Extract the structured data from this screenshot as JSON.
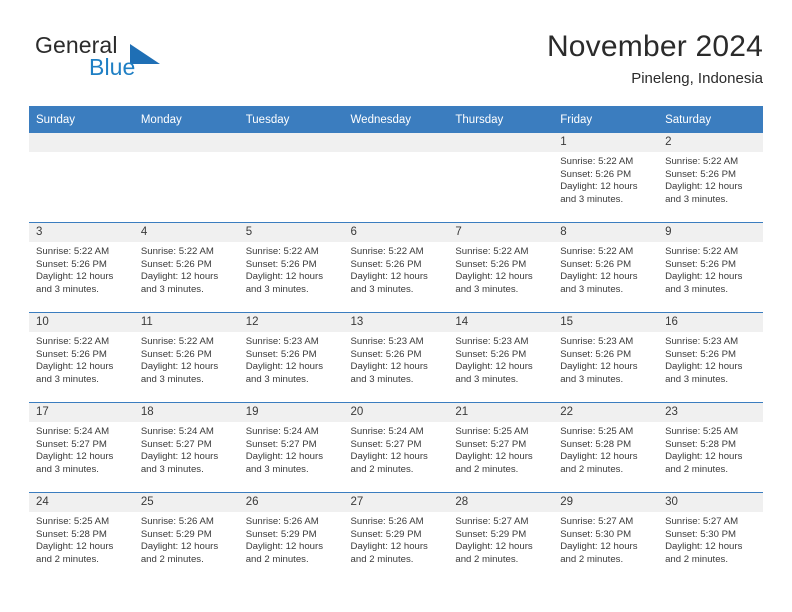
{
  "brand": {
    "name_top": "General",
    "name_bottom": "Blue",
    "accent_color": "#1f7fc4",
    "triangle_color": "#1f6fb5"
  },
  "header": {
    "title": "November 2024",
    "subtitle": "Pineleng, Indonesia"
  },
  "theme": {
    "header_row_bg": "#3b7dbf",
    "daynum_band_bg": "#f0f0f0",
    "grid_line": "#3b7dbf",
    "text": "#3a3a3a"
  },
  "weekday_headers": [
    "Sunday",
    "Monday",
    "Tuesday",
    "Wednesday",
    "Thursday",
    "Friday",
    "Saturday"
  ],
  "weeks": [
    [
      {
        "day": "",
        "empty": true,
        "sunrise": "",
        "sunset": "",
        "daylight_1": "",
        "daylight_2": ""
      },
      {
        "day": "",
        "empty": true,
        "sunrise": "",
        "sunset": "",
        "daylight_1": "",
        "daylight_2": ""
      },
      {
        "day": "",
        "empty": true,
        "sunrise": "",
        "sunset": "",
        "daylight_1": "",
        "daylight_2": ""
      },
      {
        "day": "",
        "empty": true,
        "sunrise": "",
        "sunset": "",
        "daylight_1": "",
        "daylight_2": ""
      },
      {
        "day": "",
        "empty": true,
        "sunrise": "",
        "sunset": "",
        "daylight_1": "",
        "daylight_2": ""
      },
      {
        "day": "1",
        "sunrise": "Sunrise: 5:22 AM",
        "sunset": "Sunset: 5:26 PM",
        "daylight_1": "Daylight: 12 hours",
        "daylight_2": "and 3 minutes."
      },
      {
        "day": "2",
        "sunrise": "Sunrise: 5:22 AM",
        "sunset": "Sunset: 5:26 PM",
        "daylight_1": "Daylight: 12 hours",
        "daylight_2": "and 3 minutes."
      }
    ],
    [
      {
        "day": "3",
        "sunrise": "Sunrise: 5:22 AM",
        "sunset": "Sunset: 5:26 PM",
        "daylight_1": "Daylight: 12 hours",
        "daylight_2": "and 3 minutes."
      },
      {
        "day": "4",
        "sunrise": "Sunrise: 5:22 AM",
        "sunset": "Sunset: 5:26 PM",
        "daylight_1": "Daylight: 12 hours",
        "daylight_2": "and 3 minutes."
      },
      {
        "day": "5",
        "sunrise": "Sunrise: 5:22 AM",
        "sunset": "Sunset: 5:26 PM",
        "daylight_1": "Daylight: 12 hours",
        "daylight_2": "and 3 minutes."
      },
      {
        "day": "6",
        "sunrise": "Sunrise: 5:22 AM",
        "sunset": "Sunset: 5:26 PM",
        "daylight_1": "Daylight: 12 hours",
        "daylight_2": "and 3 minutes."
      },
      {
        "day": "7",
        "sunrise": "Sunrise: 5:22 AM",
        "sunset": "Sunset: 5:26 PM",
        "daylight_1": "Daylight: 12 hours",
        "daylight_2": "and 3 minutes."
      },
      {
        "day": "8",
        "sunrise": "Sunrise: 5:22 AM",
        "sunset": "Sunset: 5:26 PM",
        "daylight_1": "Daylight: 12 hours",
        "daylight_2": "and 3 minutes."
      },
      {
        "day": "9",
        "sunrise": "Sunrise: 5:22 AM",
        "sunset": "Sunset: 5:26 PM",
        "daylight_1": "Daylight: 12 hours",
        "daylight_2": "and 3 minutes."
      }
    ],
    [
      {
        "day": "10",
        "sunrise": "Sunrise: 5:22 AM",
        "sunset": "Sunset: 5:26 PM",
        "daylight_1": "Daylight: 12 hours",
        "daylight_2": "and 3 minutes."
      },
      {
        "day": "11",
        "sunrise": "Sunrise: 5:22 AM",
        "sunset": "Sunset: 5:26 PM",
        "daylight_1": "Daylight: 12 hours",
        "daylight_2": "and 3 minutes."
      },
      {
        "day": "12",
        "sunrise": "Sunrise: 5:23 AM",
        "sunset": "Sunset: 5:26 PM",
        "daylight_1": "Daylight: 12 hours",
        "daylight_2": "and 3 minutes."
      },
      {
        "day": "13",
        "sunrise": "Sunrise: 5:23 AM",
        "sunset": "Sunset: 5:26 PM",
        "daylight_1": "Daylight: 12 hours",
        "daylight_2": "and 3 minutes."
      },
      {
        "day": "14",
        "sunrise": "Sunrise: 5:23 AM",
        "sunset": "Sunset: 5:26 PM",
        "daylight_1": "Daylight: 12 hours",
        "daylight_2": "and 3 minutes."
      },
      {
        "day": "15",
        "sunrise": "Sunrise: 5:23 AM",
        "sunset": "Sunset: 5:26 PM",
        "daylight_1": "Daylight: 12 hours",
        "daylight_2": "and 3 minutes."
      },
      {
        "day": "16",
        "sunrise": "Sunrise: 5:23 AM",
        "sunset": "Sunset: 5:26 PM",
        "daylight_1": "Daylight: 12 hours",
        "daylight_2": "and 3 minutes."
      }
    ],
    [
      {
        "day": "17",
        "sunrise": "Sunrise: 5:24 AM",
        "sunset": "Sunset: 5:27 PM",
        "daylight_1": "Daylight: 12 hours",
        "daylight_2": "and 3 minutes."
      },
      {
        "day": "18",
        "sunrise": "Sunrise: 5:24 AM",
        "sunset": "Sunset: 5:27 PM",
        "daylight_1": "Daylight: 12 hours",
        "daylight_2": "and 3 minutes."
      },
      {
        "day": "19",
        "sunrise": "Sunrise: 5:24 AM",
        "sunset": "Sunset: 5:27 PM",
        "daylight_1": "Daylight: 12 hours",
        "daylight_2": "and 3 minutes."
      },
      {
        "day": "20",
        "sunrise": "Sunrise: 5:24 AM",
        "sunset": "Sunset: 5:27 PM",
        "daylight_1": "Daylight: 12 hours",
        "daylight_2": "and 2 minutes."
      },
      {
        "day": "21",
        "sunrise": "Sunrise: 5:25 AM",
        "sunset": "Sunset: 5:27 PM",
        "daylight_1": "Daylight: 12 hours",
        "daylight_2": "and 2 minutes."
      },
      {
        "day": "22",
        "sunrise": "Sunrise: 5:25 AM",
        "sunset": "Sunset: 5:28 PM",
        "daylight_1": "Daylight: 12 hours",
        "daylight_2": "and 2 minutes."
      },
      {
        "day": "23",
        "sunrise": "Sunrise: 5:25 AM",
        "sunset": "Sunset: 5:28 PM",
        "daylight_1": "Daylight: 12 hours",
        "daylight_2": "and 2 minutes."
      }
    ],
    [
      {
        "day": "24",
        "sunrise": "Sunrise: 5:25 AM",
        "sunset": "Sunset: 5:28 PM",
        "daylight_1": "Daylight: 12 hours",
        "daylight_2": "and 2 minutes."
      },
      {
        "day": "25",
        "sunrise": "Sunrise: 5:26 AM",
        "sunset": "Sunset: 5:29 PM",
        "daylight_1": "Daylight: 12 hours",
        "daylight_2": "and 2 minutes."
      },
      {
        "day": "26",
        "sunrise": "Sunrise: 5:26 AM",
        "sunset": "Sunset: 5:29 PM",
        "daylight_1": "Daylight: 12 hours",
        "daylight_2": "and 2 minutes."
      },
      {
        "day": "27",
        "sunrise": "Sunrise: 5:26 AM",
        "sunset": "Sunset: 5:29 PM",
        "daylight_1": "Daylight: 12 hours",
        "daylight_2": "and 2 minutes."
      },
      {
        "day": "28",
        "sunrise": "Sunrise: 5:27 AM",
        "sunset": "Sunset: 5:29 PM",
        "daylight_1": "Daylight: 12 hours",
        "daylight_2": "and 2 minutes."
      },
      {
        "day": "29",
        "sunrise": "Sunrise: 5:27 AM",
        "sunset": "Sunset: 5:30 PM",
        "daylight_1": "Daylight: 12 hours",
        "daylight_2": "and 2 minutes."
      },
      {
        "day": "30",
        "sunrise": "Sunrise: 5:27 AM",
        "sunset": "Sunset: 5:30 PM",
        "daylight_1": "Daylight: 12 hours",
        "daylight_2": "and 2 minutes."
      }
    ]
  ]
}
